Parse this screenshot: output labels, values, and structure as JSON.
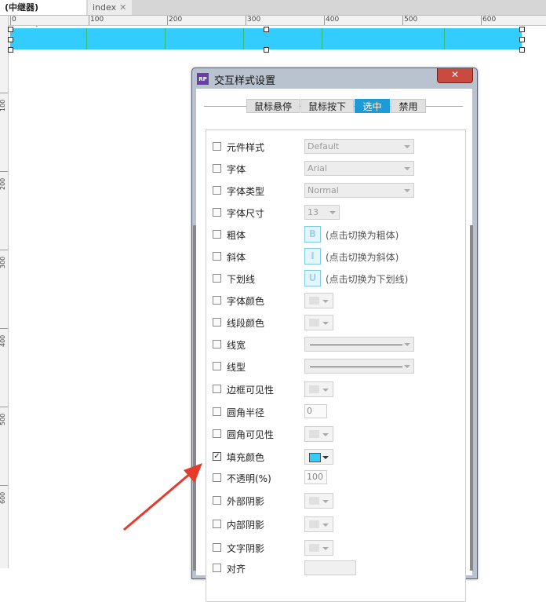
{
  "tabs": [
    {
      "label": "(中继器) (index)",
      "close": "✕",
      "active": true
    },
    {
      "label": "index",
      "close": "✕",
      "active": false
    }
  ],
  "ruler": {
    "h_labels": [
      "0",
      "100",
      "200",
      "300",
      "400",
      "500",
      "600"
    ],
    "v_labels": [
      "100",
      "200",
      "300",
      "400",
      "500",
      "600"
    ]
  },
  "colors": {
    "repeater_fill": "#33ccff",
    "accent_tab": "#1e9bd7",
    "fill_swatch": "#33ccff"
  },
  "dialog": {
    "logo": "RP",
    "title": "交互样式设置",
    "close_icon": "x-icon",
    "state_tabs": [
      "鼠标悬停",
      "鼠标按下",
      "选中",
      "禁用"
    ],
    "selected_tab": "选中",
    "rows": [
      {
        "label": "元件样式",
        "checked": false,
        "control": "select",
        "value": "Default"
      },
      {
        "label": "字体",
        "checked": false,
        "control": "select",
        "value": "Arial"
      },
      {
        "label": "字体类型",
        "checked": false,
        "control": "select",
        "value": "Normal"
      },
      {
        "label": "字体尺寸",
        "checked": false,
        "control": "select",
        "value": "13"
      },
      {
        "label": "粗体",
        "checked": false,
        "control": "format",
        "glyph": "B",
        "hint": "(点击切换为粗体)"
      },
      {
        "label": "斜体",
        "checked": false,
        "control": "format",
        "glyph": "I",
        "hint": "(点击切换为斜体)"
      },
      {
        "label": "下划线",
        "checked": false,
        "control": "format",
        "glyph": "U",
        "hint": "(点击切换为下划线)"
      },
      {
        "label": "字体颜色",
        "checked": false,
        "control": "color",
        "icon": "font-color-icon"
      },
      {
        "label": "线段颜色",
        "checked": false,
        "control": "color",
        "icon": "pen-icon"
      },
      {
        "label": "线宽",
        "checked": false,
        "control": "line"
      },
      {
        "label": "线型",
        "checked": false,
        "control": "line"
      },
      {
        "label": "边框可见性",
        "checked": false,
        "control": "color",
        "icon": "border-icon"
      },
      {
        "label": "圆角半径",
        "checked": false,
        "control": "input",
        "value": "0"
      },
      {
        "label": "圆角可见性",
        "checked": false,
        "control": "color",
        "icon": "rounded-corner-icon"
      },
      {
        "label": "填充颜色",
        "checked": true,
        "control": "color",
        "icon": "fill-color-icon"
      },
      {
        "label": "不透明(%)",
        "checked": false,
        "control": "input",
        "value": "100"
      },
      {
        "label": "外部阴影",
        "checked": false,
        "control": "color",
        "icon": "outer-shadow-icon"
      },
      {
        "label": "内部阴影",
        "checked": false,
        "control": "color",
        "icon": "inner-shadow-icon"
      },
      {
        "label": "文字阴影",
        "checked": false,
        "control": "color",
        "icon": "text-shadow-icon"
      },
      {
        "label": "对齐",
        "checked": false,
        "control": "align"
      }
    ]
  },
  "checkmark": "✓"
}
